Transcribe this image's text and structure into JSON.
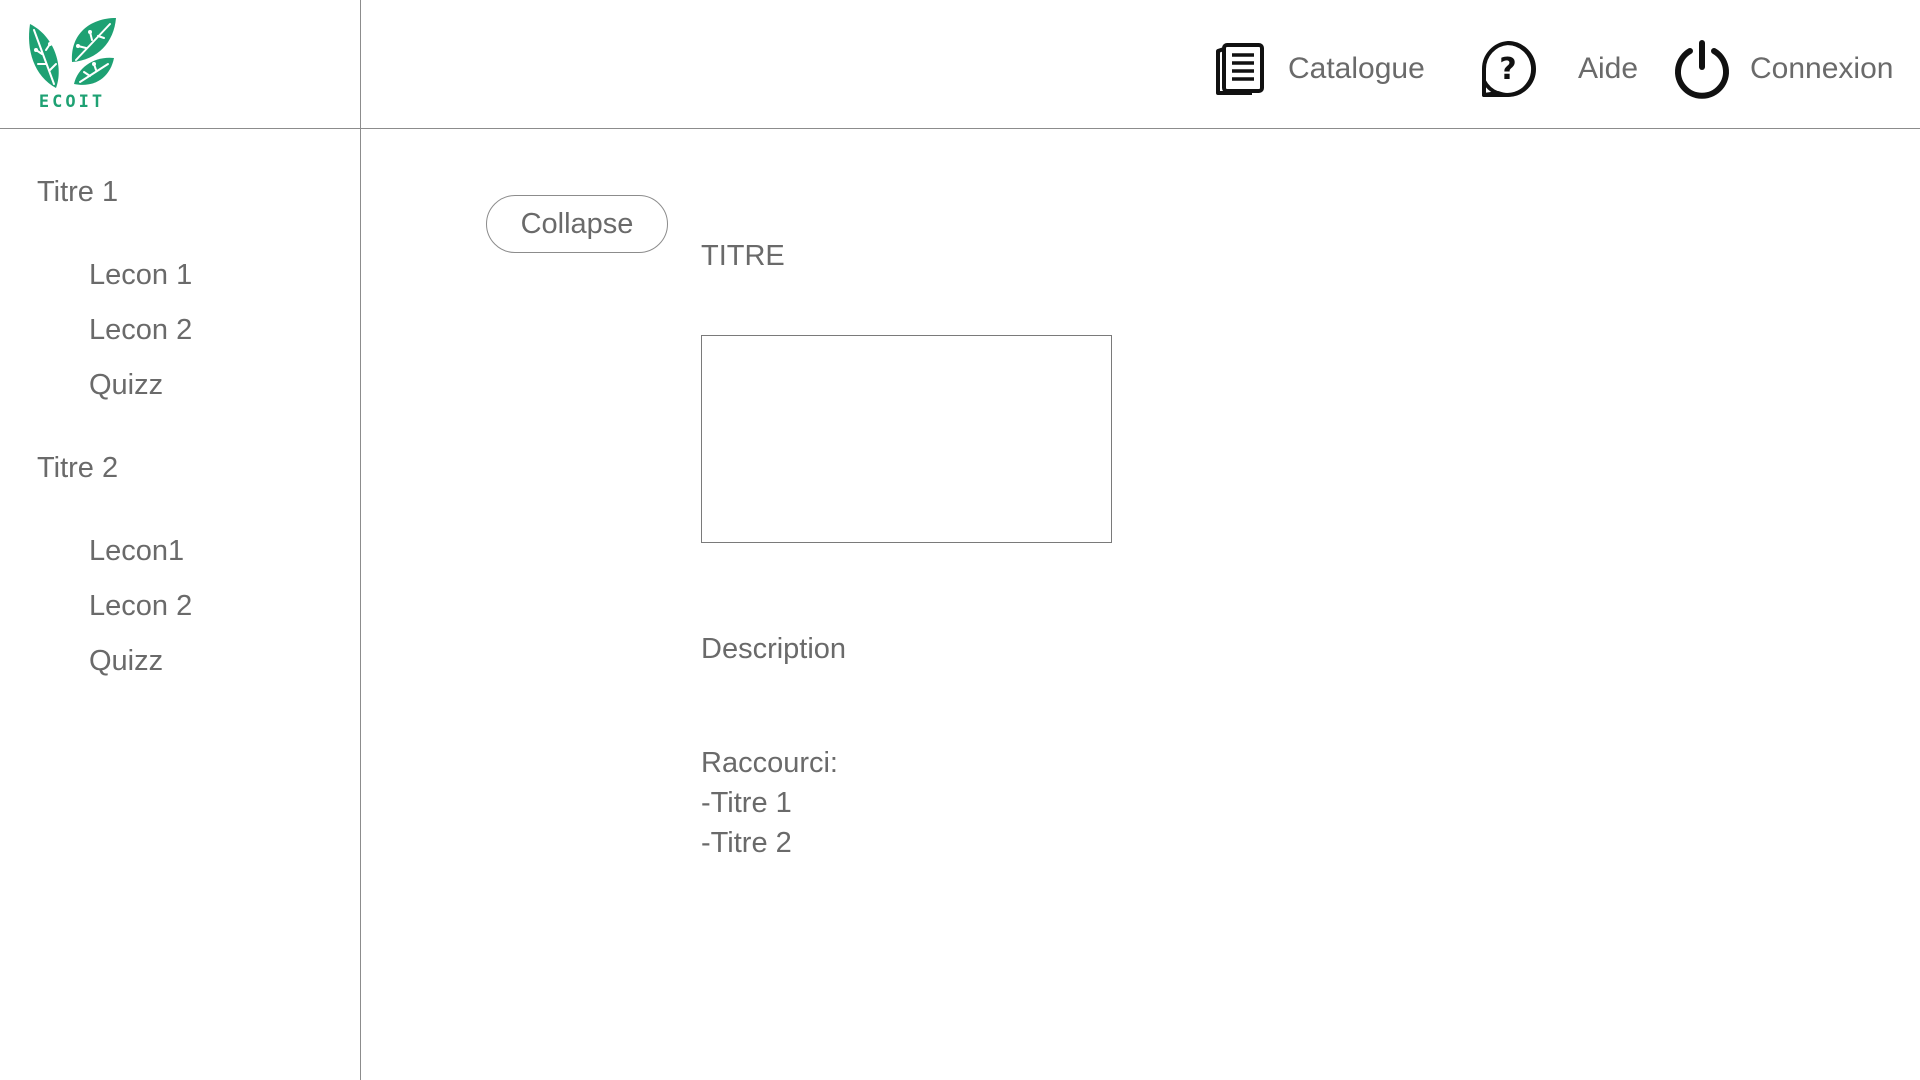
{
  "header": {
    "logo_text": "ECOIT",
    "nav": [
      {
        "icon": "catalogue-book-icon",
        "label": "Catalogue"
      },
      {
        "icon": "help-question-icon",
        "label": "Aide"
      },
      {
        "icon": "power-icon",
        "label": "Connexion"
      }
    ]
  },
  "sidebar": {
    "sections": [
      {
        "title": "Titre 1",
        "items": [
          "Lecon 1",
          "Lecon 2",
          "Quizz"
        ]
      },
      {
        "title": "Titre 2",
        "items": [
          "Lecon1",
          "Lecon 2",
          "Quizz"
        ]
      }
    ]
  },
  "main": {
    "collapse_label": "Collapse",
    "title": "TITRE",
    "description": "Description",
    "shortcuts_label": "Raccourci:",
    "shortcuts": [
      "-Titre 1",
      "-Titre 2"
    ]
  },
  "colors": {
    "brand": "#1ea173",
    "text": "#6a6a6a",
    "divider": "#8c8c8c"
  }
}
